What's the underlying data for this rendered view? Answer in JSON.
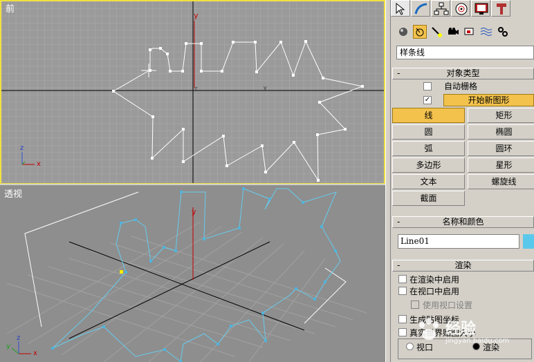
{
  "viewports": {
    "front_label": "前",
    "perspective_label": "透视"
  },
  "colors": {
    "viewport_active_border": "#f0e040",
    "spline_selected": "#ffffff",
    "spline_perspective": "#66ccee",
    "accent_button": "#f3c24d",
    "object_color": "#5ac8ea"
  },
  "command_panel": {
    "tab_icons": [
      "create-icon",
      "modify-icon",
      "hierarchy-icon",
      "motion-icon",
      "display-icon",
      "utilities-icon"
    ],
    "subcategory_icons": [
      "geometry-icon",
      "shapes-icon",
      "lights-icon",
      "cameras-icon",
      "helpers-icon",
      "spacewarps-icon",
      "systems-icon"
    ],
    "category_dropdown": "样条线",
    "object_type": {
      "header": "对象类型",
      "autogrid_label": "自动栅格",
      "start_new_shape_label": "开始新图形",
      "start_new_shape_checked": true,
      "buttons": [
        "线",
        "矩形",
        "圆",
        "椭圆",
        "弧",
        "圆环",
        "多边形",
        "星形",
        "文本",
        "螺旋线",
        "截面"
      ],
      "active_button": "线"
    },
    "name_color": {
      "header": "名称和颜色",
      "name": "Line01"
    },
    "rendering": {
      "header": "渲染",
      "enable_in_renderer": "在渲染中启用",
      "enable_in_viewport": "在视口中启用",
      "use_viewport_settings": "使用视口设置",
      "generate_mapping": "生成贴图坐标",
      "real_world_map_size": "真实世界贴图大小",
      "viewport_option": "视口",
      "renderer_option": "渲染"
    },
    "collapse_symbol": "-"
  },
  "watermark": {
    "text": "经验",
    "url": "jingyan.baidu.com"
  }
}
